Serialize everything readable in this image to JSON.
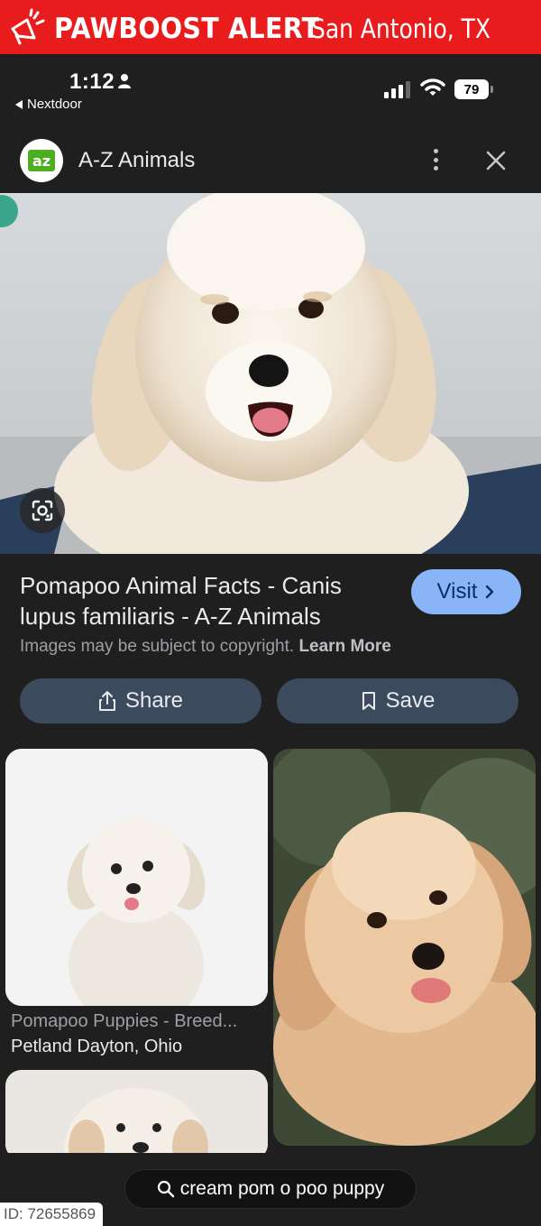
{
  "alert": {
    "title": "PAWBOOST ALERT",
    "city": "San Antonio, TX",
    "icon": "megaphone-paw-icon",
    "bg_color": "#e81c1c"
  },
  "status_bar": {
    "time": "1:12",
    "back_app": "Nextdoor",
    "battery_level": "79",
    "signal_bars": 3,
    "icons": [
      "person-icon",
      "signal-icon",
      "wifi-icon",
      "battery-icon"
    ]
  },
  "source": {
    "name": "A-Z Animals",
    "logo_text": "az",
    "logo_color": "#4caf1f"
  },
  "result": {
    "title": "Pomapoo Animal Facts - Canis lupus familiaris - A-Z Animals",
    "visit_label": "Visit",
    "copyright_text": "Images may be subject to copyright.",
    "learn_more_label": "Learn More",
    "accent_color": "#8ab4f8"
  },
  "actions": {
    "share_label": "Share",
    "save_label": "Save"
  },
  "related": [
    {
      "title": "Pomapoo Puppies - Breed...",
      "source": "Petland Dayton, Ohio"
    },
    {
      "title": "",
      "source": ""
    },
    {
      "title": "",
      "source": ""
    }
  ],
  "search": {
    "query": "cream pom o poo puppy"
  },
  "watermark": {
    "id_text": "ID: 72655869"
  }
}
